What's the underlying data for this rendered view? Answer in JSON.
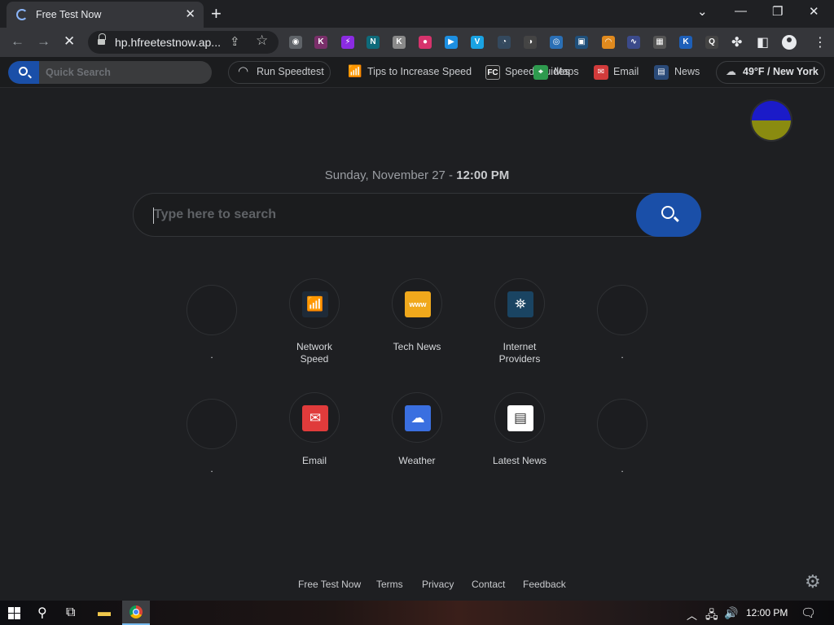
{
  "browser": {
    "tab_title": "Free Test Now",
    "tab_close": "✕",
    "new_tab": "+",
    "url": "hp.hfreetestnow.ap...",
    "window": {
      "tabs_menu": "⌄",
      "minimize": "—",
      "restore": "❐",
      "close": "✕"
    },
    "nav": {
      "back": "←",
      "forward": "→",
      "stop": "✕"
    }
  },
  "extensions": [
    {
      "name": "camera-icon",
      "glyph": "◉",
      "color": "#5f6368"
    },
    {
      "name": "k-icon",
      "glyph": "K",
      "color": "#7a2f6a"
    },
    {
      "name": "bolt-icon",
      "glyph": "⚡",
      "color": "#8b2be2"
    },
    {
      "name": "n-icon",
      "glyph": "N",
      "color": "#0e6a7a"
    },
    {
      "name": "k2-icon",
      "glyph": "K",
      "color": "#8a8a8a"
    },
    {
      "name": "game-icon",
      "glyph": "●",
      "color": "#d6336c"
    },
    {
      "name": "play-icon",
      "glyph": "▶",
      "color": "#1d8fe1"
    },
    {
      "name": "v-icon",
      "glyph": "V",
      "color": "#1aa3e3"
    },
    {
      "name": "speedometer-icon",
      "glyph": "◔",
      "color": "#34495e"
    },
    {
      "name": "gauge-icon",
      "glyph": "◑",
      "color": "#444"
    },
    {
      "name": "ring-icon",
      "glyph": "◎",
      "color": "#2a6fb5"
    },
    {
      "name": "monitor-icon",
      "glyph": "▣",
      "color": "#1f4f7a"
    },
    {
      "name": "rainbow-icon",
      "glyph": "◠",
      "color": "#e08a1e"
    },
    {
      "name": "wave-icon",
      "glyph": "∿",
      "color": "#3b4a8a"
    },
    {
      "name": "chart-icon",
      "glyph": "▦",
      "color": "#555"
    },
    {
      "name": "k3-icon",
      "glyph": "K",
      "color": "#1d5fb8"
    },
    {
      "name": "q-icon",
      "glyph": "Q",
      "color": "#444"
    }
  ],
  "pagebar": {
    "quick_search": "Quick Search",
    "run_speedtest": "Run Speedtest",
    "tips": "Tips to Increase Speed",
    "speed_guides": "Speed Guides",
    "maps": "Maps",
    "email": "Email",
    "news": "News",
    "weather": "49°F / New York"
  },
  "main": {
    "date": "Sunday, November 27 - ",
    "time": "12:00 PM",
    "search_placeholder": "Type here to search"
  },
  "tiles": [
    {
      "label": ".",
      "icon": "",
      "color": ""
    },
    {
      "label": "Network Speed",
      "icon": "wifi-speed-icon",
      "color": "#1e2a38"
    },
    {
      "label": "Tech News",
      "icon": "www-icon",
      "color": "#f0a81c"
    },
    {
      "label": "Internet Providers",
      "icon": "satellite-icon",
      "color": "#1a4462"
    },
    {
      "label": ".",
      "icon": "",
      "color": ""
    },
    {
      "label": ".",
      "icon": "",
      "color": ""
    },
    {
      "label": "Email",
      "icon": "envelope-icon",
      "color": "#e03b3b"
    },
    {
      "label": "Weather",
      "icon": "cloud-icon",
      "color": "#3a6fe0"
    },
    {
      "label": "Latest News",
      "icon": "newspaper-icon",
      "color": "#ffffff"
    },
    {
      "label": ".",
      "icon": "",
      "color": ""
    }
  ],
  "footer": {
    "links": [
      "Free Test Now",
      "Terms",
      "Privacy",
      "Contact",
      "Feedback"
    ]
  },
  "taskbar": {
    "time": "12:00 PM"
  }
}
